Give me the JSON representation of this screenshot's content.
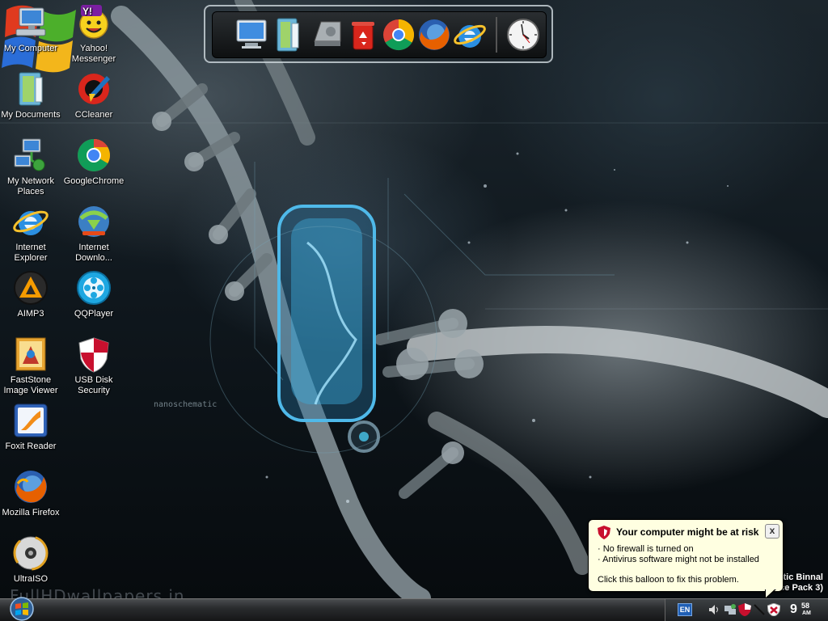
{
  "desktop": {
    "icons": [
      {
        "label": "My Computer",
        "icon": "computer-icon"
      },
      {
        "label": "Yahoo! Messenger",
        "icon": "yahoo-messenger-icon"
      },
      {
        "label": "My Documents",
        "icon": "documents-folder-icon"
      },
      {
        "label": "CCleaner",
        "icon": "ccleaner-icon"
      },
      {
        "label": "My Network Places",
        "icon": "network-icon"
      },
      {
        "label": "GoogleChrome",
        "icon": "chrome-icon"
      },
      {
        "label": "Internet Explorer",
        "icon": "internet-explorer-icon"
      },
      {
        "label": "Internet Downlo...",
        "icon": "internet-download-manager-icon"
      },
      {
        "label": "AIMP3",
        "icon": "aimp-icon"
      },
      {
        "label": "QQPlayer",
        "icon": "qqplayer-icon"
      },
      {
        "label": "FastStone Image Viewer",
        "icon": "faststone-icon"
      },
      {
        "label": "USB Disk Security",
        "icon": "usb-shield-icon"
      },
      {
        "label": "Foxit Reader",
        "icon": "foxit-icon"
      },
      {
        "label": "Mozilla Firefox",
        "icon": "firefox-icon"
      },
      {
        "label": "UltraISO",
        "icon": "ultraiso-icon"
      }
    ]
  },
  "dock": {
    "items": [
      "computer-icon",
      "documents-folder-icon",
      "network-drive-icon",
      "recycle-bin-icon",
      "chrome-icon",
      "firefox-icon",
      "internet-explorer-icon",
      "clock-icon"
    ]
  },
  "wallpaper": {
    "brand_text": "nanoschematic",
    "watermark": "FullHDwallpapers.in",
    "caption_line1": "tic Binnal",
    "caption_line2": "ce Pack 3)"
  },
  "balloon": {
    "title": "Your computer might be at risk",
    "line1": "· No firewall is turned on",
    "line2": "· Antivirus software might not be installed",
    "line3": "Click this balloon to fix this problem.",
    "close_label": "x"
  },
  "taskbar": {
    "language": "EN",
    "clock_hour": "9",
    "clock_minute": "58",
    "clock_ampm": "AM"
  },
  "colors": {
    "balloon_bg": "#ffffe1",
    "shield_red": "#c8102e",
    "taskbar_dark": "#151617"
  }
}
